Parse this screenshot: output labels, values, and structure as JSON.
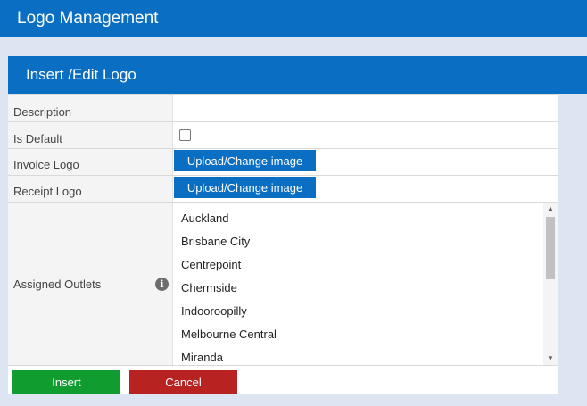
{
  "page": {
    "title": "Logo Management"
  },
  "panel": {
    "title": "Insert /Edit Logo"
  },
  "form": {
    "description": {
      "label": "Description",
      "value": ""
    },
    "is_default": {
      "label": "Is Default",
      "checked": false
    },
    "invoice_logo": {
      "label": "Invoice Logo",
      "button_label": "Upload/Change image"
    },
    "receipt_logo": {
      "label": "Receipt Logo",
      "button_label": "Upload/Change image"
    },
    "assigned_outlets": {
      "label": "Assigned Outlets",
      "info_icon": "info-icon",
      "items": [
        "Auckland",
        "Brisbane City",
        "Centrepoint",
        "Chermside",
        "Indooroopilly",
        "Melbourne Central",
        "Miranda"
      ]
    }
  },
  "actions": {
    "insert_label": "Insert",
    "cancel_label": "Cancel"
  },
  "colors": {
    "header": "#0a6fc2",
    "insert": "#119c2f",
    "cancel": "#b82321"
  }
}
